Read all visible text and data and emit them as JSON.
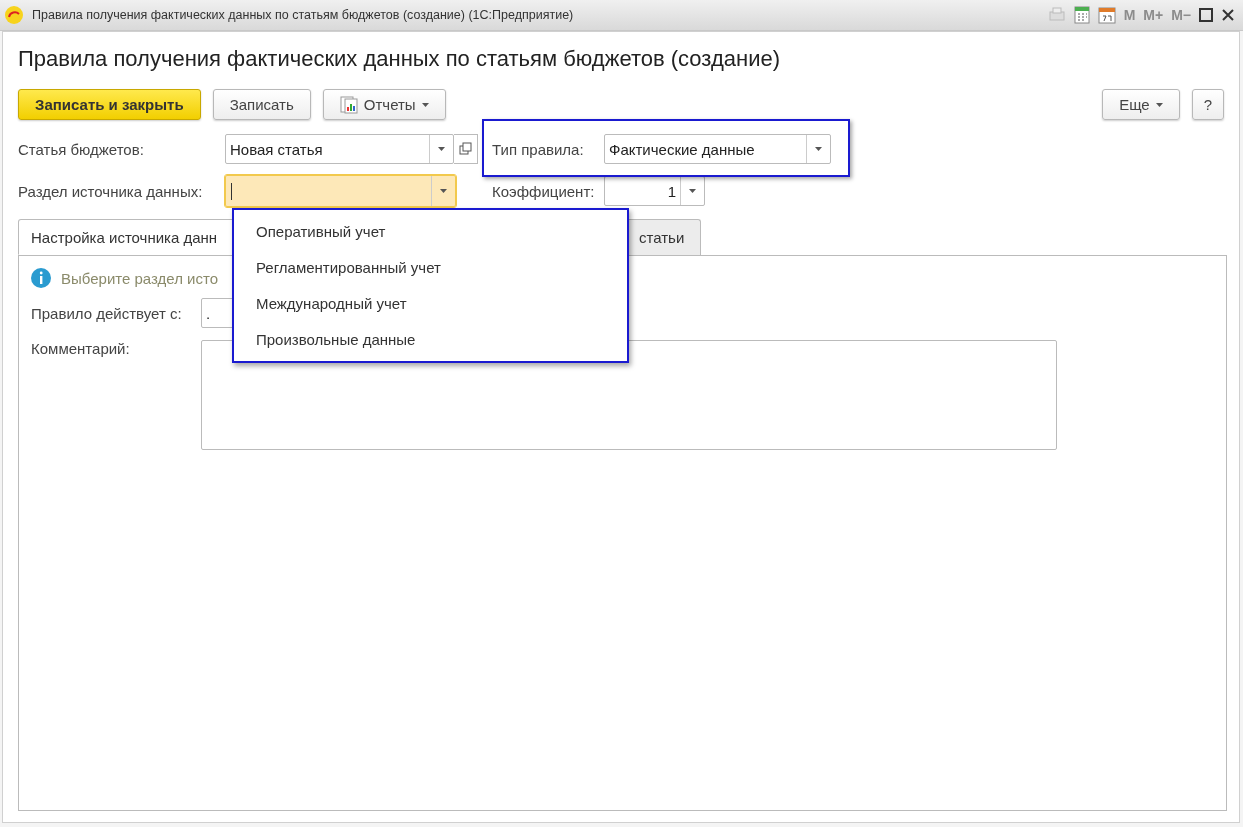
{
  "window": {
    "title": "Правила получения фактических данных по статьям бюджетов (создание)  (1С:Предприятие)",
    "tools": [
      "M",
      "M+",
      "M−"
    ]
  },
  "heading": "Правила получения фактических данных по статьям бюджетов (создание)",
  "toolbar": {
    "buttons": [
      {
        "label": "Записать и закрыть",
        "kind": "primary"
      },
      {
        "label": "Записать",
        "kind": "plain"
      },
      {
        "label": "Отчеты",
        "kind": "menu"
      }
    ],
    "more": "Еще",
    "help": "?"
  },
  "fields": {
    "budget_item": {
      "label": "Статья бюджетов:",
      "value": "Новая статья"
    },
    "rule_type": {
      "label": "Тип правила:",
      "value": "Фактические данные",
      "highlighted": true
    },
    "source_section": {
      "label": "Раздел источника данных:",
      "focused": true
    },
    "coefficient": {
      "label": "Коэффициент:",
      "value": "1"
    }
  },
  "tabs": [
    {
      "label": "Настройка источника данн",
      "selected": true
    },
    {
      "label": "статьи",
      "selected": false
    }
  ],
  "panel": {
    "info": "Выберите раздел исто",
    "valid_from": {
      "label": "Правило действует с:",
      "value": "."
    },
    "comment": {
      "label": "Комментарий:"
    }
  },
  "dropdown": {
    "highlighted": true,
    "options": [
      "Оперативный учет",
      "Регламентированный учет",
      "Международный учет",
      "Произвольные данные"
    ]
  }
}
